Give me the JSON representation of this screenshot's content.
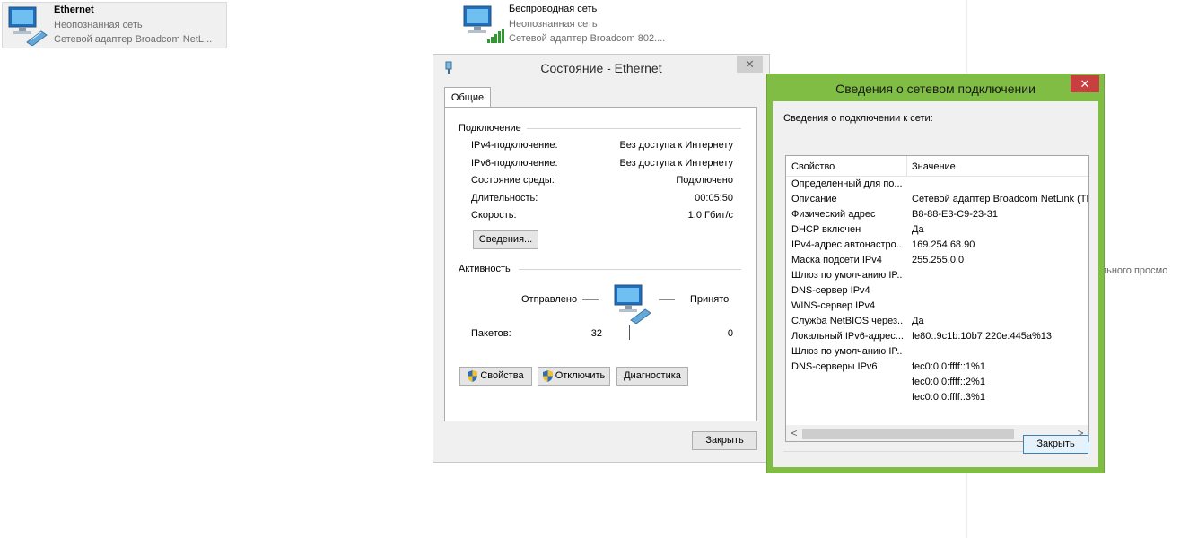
{
  "adapters": [
    {
      "name": "Ethernet",
      "status": "Неопознанная сеть",
      "device": "Сетевой адаптер Broadcom NetL...",
      "icon": "ethernet-adapter-icon"
    },
    {
      "name": "Беспроводная сеть",
      "status": "Неопознанная сеть",
      "device": "Сетевой адаптер Broadcom 802....",
      "icon": "wireless-adapter-icon"
    }
  ],
  "background_text": "тельного просмо",
  "status_dialog": {
    "title": "Состояние - Ethernet",
    "close": "✕",
    "tab": "Общие",
    "connection_group": "Подключение",
    "rows": [
      {
        "label": "IPv4-подключение:",
        "value": "Без доступа к Интернету"
      },
      {
        "label": "IPv6-подключение:",
        "value": "Без доступа к Интернету"
      },
      {
        "label": "Состояние среды:",
        "value": "Подключено"
      },
      {
        "label": "Длительность:",
        "value": "00:05:50"
      },
      {
        "label": "Скорость:",
        "value": "1.0 Гбит/с"
      }
    ],
    "details_button": "Сведения...",
    "activity_group": "Активность",
    "sent_label": "Отправлено",
    "received_label": "Принято",
    "packets_label": "Пакетов:",
    "packets_sent": "32",
    "packets_received": "0",
    "properties_button": "Свойства",
    "disable_button": "Отключить",
    "diagnose_button": "Диагностика",
    "close_button": "Закрыть"
  },
  "details_dialog": {
    "title": "Сведения о сетевом подключении",
    "close": "✕",
    "caption": "Сведения о подключении к сети:",
    "col_property": "Свойство",
    "col_value": "Значение",
    "rows": [
      {
        "prop": "Определенный для по...",
        "value": ""
      },
      {
        "prop": "Описание",
        "value": "Сетевой адаптер Broadcom NetLink (TM"
      },
      {
        "prop": "Физический адрес",
        "value": "B8-88-E3-C9-23-31"
      },
      {
        "prop": "DHCP включен",
        "value": "Да"
      },
      {
        "prop": "IPv4-адрес автонастро...",
        "value": "169.254.68.90"
      },
      {
        "prop": "Маска подсети IPv4",
        "value": "255.255.0.0"
      },
      {
        "prop": "Шлюз по умолчанию IP...",
        "value": ""
      },
      {
        "prop": "DNS-сервер IPv4",
        "value": ""
      },
      {
        "prop": "WINS-сервер IPv4",
        "value": ""
      },
      {
        "prop": "Служба NetBIOS через...",
        "value": "Да"
      },
      {
        "prop": "Локальный IPv6-адрес...",
        "value": "fe80::9c1b:10b7:220e:445a%13"
      },
      {
        "prop": "Шлюз по умолчанию IP...",
        "value": ""
      },
      {
        "prop": "DNS-серверы IPv6",
        "value": "fec0:0:0:ffff::1%1"
      },
      {
        "prop": "",
        "value": "fec0:0:0:ffff::2%1"
      },
      {
        "prop": "",
        "value": "fec0:0:0:ffff::3%1"
      }
    ],
    "scroll_left": "<",
    "scroll_right": ">",
    "close_button": "Закрыть"
  },
  "colors": {
    "details_frame": "#7fbd44",
    "close_red": "#c73f3f",
    "signal_green": "#2e9b2e"
  }
}
